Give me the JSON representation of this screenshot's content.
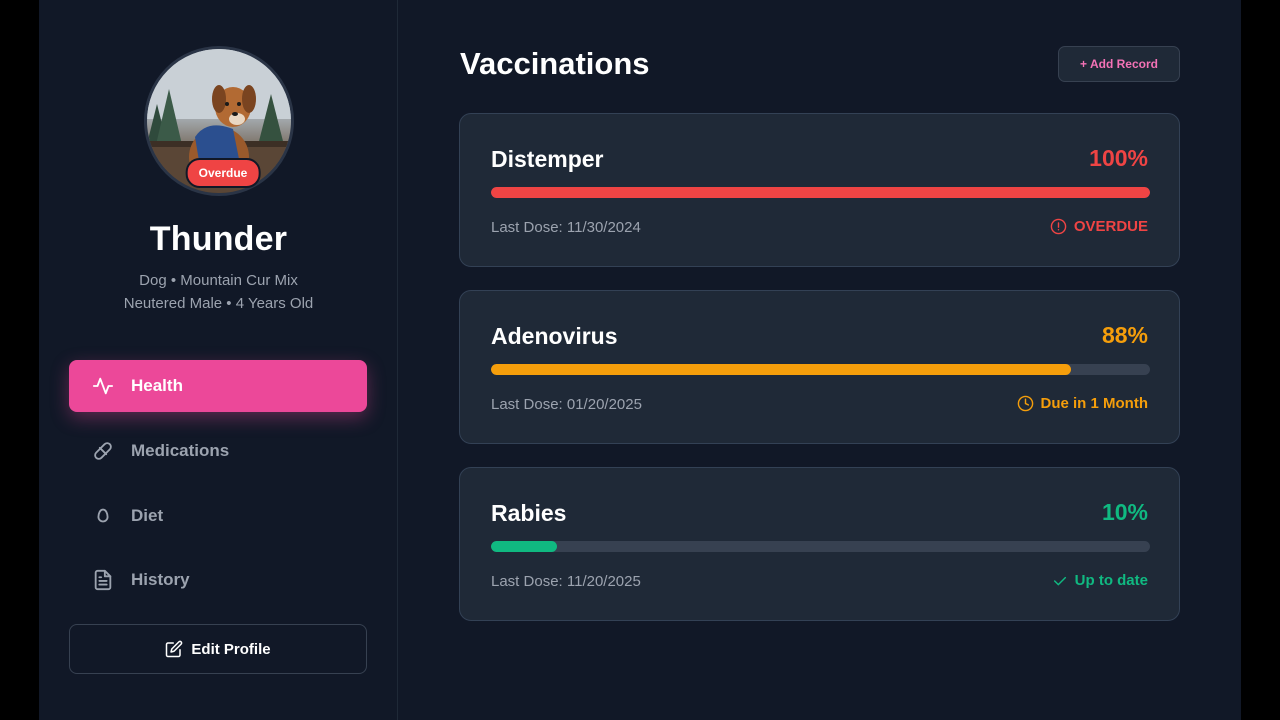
{
  "colors": {
    "accent": "#ec4899",
    "accent_text": "#f472b6",
    "overdue": "#ef4444",
    "due_soon": "#f59e0b",
    "up_to_date": "#10b981"
  },
  "pet": {
    "name": "Thunder",
    "status_badge": "Overdue",
    "info_line_1": "Dog • Mountain Cur Mix",
    "info_line_2": "Neutered Male • 4 Years Old"
  },
  "nav": [
    {
      "label": "Health",
      "icon": "heartbeat-icon",
      "active": true
    },
    {
      "label": "Medications",
      "icon": "pill-icon",
      "active": false
    },
    {
      "label": "Diet",
      "icon": "egg-icon",
      "active": false
    },
    {
      "label": "History",
      "icon": "document-icon",
      "active": false
    }
  ],
  "edit_profile_label": "Edit Profile",
  "main": {
    "title": "Vaccinations",
    "add_record_label": "+ Add Record"
  },
  "vaccinations": [
    {
      "name": "Distemper",
      "percent": "100%",
      "progress": 1.0,
      "last_dose": "Last Dose: 11/30/2024",
      "status": "OVERDUE",
      "status_icon": "alert-circle-icon",
      "color": "#ef4444"
    },
    {
      "name": "Adenovirus",
      "percent": "88%",
      "progress": 0.88,
      "last_dose": "Last Dose: 01/20/2025",
      "status": "Due in 1 Month",
      "status_icon": "clock-icon",
      "color": "#f59e0b"
    },
    {
      "name": "Rabies",
      "percent": "10%",
      "progress": 0.1,
      "last_dose": "Last Dose: 11/20/2025",
      "status": "Up to date",
      "status_icon": "check-icon",
      "color": "#10b981"
    }
  ]
}
